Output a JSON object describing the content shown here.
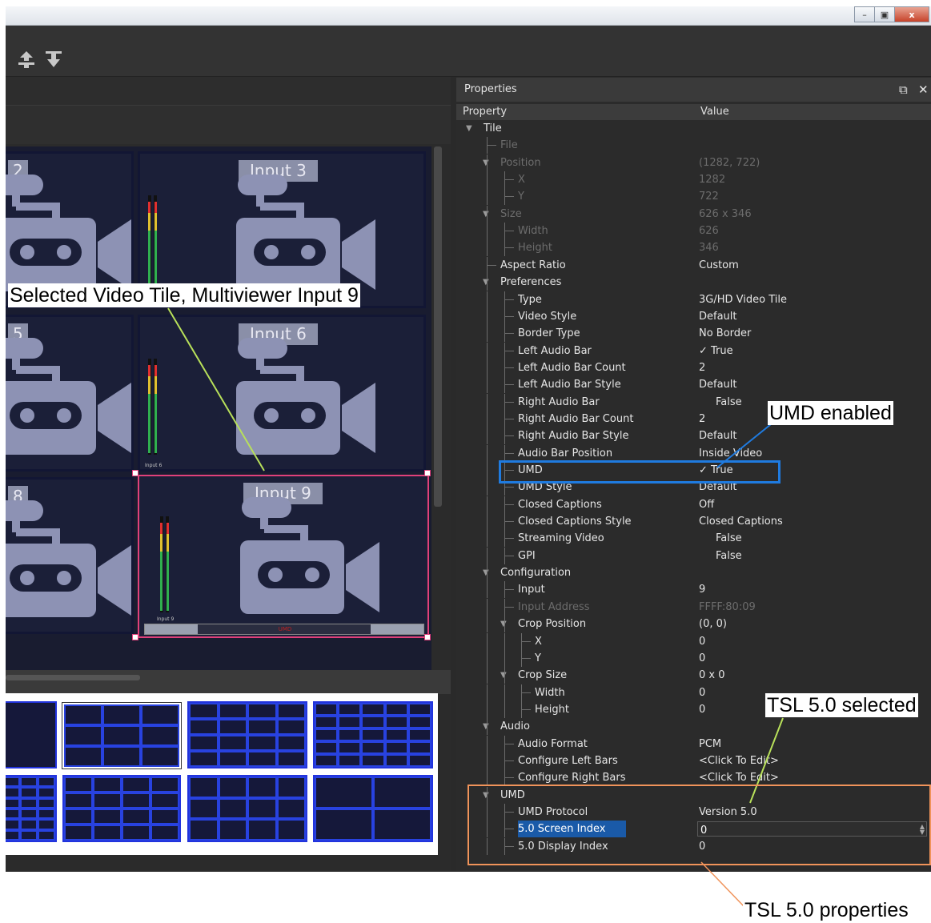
{
  "window": {
    "buttons": [
      "minimize",
      "maximize",
      "close"
    ],
    "close_glyph": "x"
  },
  "toolbar": {
    "icons": [
      "upload-icon",
      "download-icon"
    ]
  },
  "tiles": [
    {
      "label": "2"
    },
    {
      "label": "Input 3"
    },
    {
      "label": "5"
    },
    {
      "label": "Input 6",
      "tiny": "Input 6"
    },
    {
      "label": "8"
    },
    {
      "label": "Input 9",
      "tiny": "Input 9",
      "umd": "UMD"
    }
  ],
  "properties": {
    "title": "Properties",
    "col_property": "Property",
    "col_value": "Value",
    "rows": [
      {
        "name": "Tile",
        "value": "",
        "level": 0,
        "exp": true
      },
      {
        "name": "File",
        "value": "",
        "level": 1,
        "dim": true
      },
      {
        "name": "Position",
        "value": "(1282, 722)",
        "level": 1,
        "exp": true,
        "dim": true
      },
      {
        "name": "X",
        "value": "1282",
        "level": 2,
        "dim": true
      },
      {
        "name": "Y",
        "value": "722",
        "level": 2,
        "dim": true
      },
      {
        "name": "Size",
        "value": "626 x 346",
        "level": 1,
        "exp": true,
        "dim": true
      },
      {
        "name": "Width",
        "value": "626",
        "level": 2,
        "dim": true
      },
      {
        "name": "Height",
        "value": "346",
        "level": 2,
        "dim": true
      },
      {
        "name": "Aspect Ratio",
        "value": "Custom",
        "level": 1
      },
      {
        "name": "Preferences",
        "value": "",
        "level": 1,
        "exp": true
      },
      {
        "name": "Type",
        "value": "3G/HD Video Tile",
        "level": 2
      },
      {
        "name": "Video Style",
        "value": "Default",
        "level": 2
      },
      {
        "name": "Border Type",
        "value": "No Border",
        "level": 2
      },
      {
        "name": "Left Audio Bar",
        "value": "✓  True",
        "level": 2
      },
      {
        "name": "Left Audio Bar Count",
        "value": "2",
        "level": 2
      },
      {
        "name": "Left Audio Bar Style",
        "value": "Default",
        "level": 2
      },
      {
        "name": "Right Audio Bar",
        "value": "False",
        "level": 2,
        "indent": true
      },
      {
        "name": "Right Audio Bar Count",
        "value": "2",
        "level": 2
      },
      {
        "name": "Right Audio Bar Style",
        "value": "Default",
        "level": 2
      },
      {
        "name": "Audio Bar Position",
        "value": "Inside Video",
        "level": 2
      },
      {
        "name": "UMD",
        "value": "✓  True",
        "level": 2
      },
      {
        "name": "UMD Style",
        "value": "Default",
        "level": 2
      },
      {
        "name": "Closed Captions",
        "value": "Off",
        "level": 2
      },
      {
        "name": "Closed Captions Style",
        "value": "Closed Captions",
        "level": 2
      },
      {
        "name": "Streaming Video",
        "value": "False",
        "level": 2,
        "indent": true
      },
      {
        "name": "GPI",
        "value": "False",
        "level": 2,
        "indent": true
      },
      {
        "name": "Configuration",
        "value": "",
        "level": 1,
        "exp": true
      },
      {
        "name": "Input",
        "value": "9",
        "level": 2
      },
      {
        "name": "Input Address",
        "value": "FFFF:80:09",
        "level": 2,
        "dim": true
      },
      {
        "name": "Crop Position",
        "value": "(0, 0)",
        "level": 2,
        "exp": true
      },
      {
        "name": "X",
        "value": "0",
        "level": 3
      },
      {
        "name": "Y",
        "value": "0",
        "level": 3
      },
      {
        "name": "Crop Size",
        "value": "0 x 0",
        "level": 2,
        "exp": true
      },
      {
        "name": "Width",
        "value": "0",
        "level": 3
      },
      {
        "name": "Height",
        "value": "0",
        "level": 3
      },
      {
        "name": "Audio",
        "value": "",
        "level": 1,
        "exp": true
      },
      {
        "name": "Audio Format",
        "value": "PCM",
        "level": 2
      },
      {
        "name": "Configure Left Bars",
        "value": "<Click To Edit>",
        "level": 2
      },
      {
        "name": "Configure Right Bars",
        "value": "<Click To Edit>",
        "level": 2
      },
      {
        "name": "UMD",
        "value": "",
        "level": 1,
        "exp": true
      },
      {
        "name": "UMD Protocol",
        "value": "Version 5.0",
        "level": 2
      },
      {
        "name": "5.0 Screen Index",
        "value": "0",
        "level": 2,
        "selected": true
      },
      {
        "name": "5.0 Display Index",
        "value": "0",
        "level": 2
      }
    ]
  },
  "annotations": {
    "selected_tile": "Selected Video Tile, Multiviewer Input 9",
    "umd_enabled": "UMD enabled",
    "tsl_selected": "TSL 5.0 selected",
    "tsl_properties": "TSL 5.0 properties",
    "colors": {
      "blue": "#1f7be0",
      "green": "#b8e05a",
      "orange": "#f0935a",
      "pink": "#e0407a"
    }
  }
}
